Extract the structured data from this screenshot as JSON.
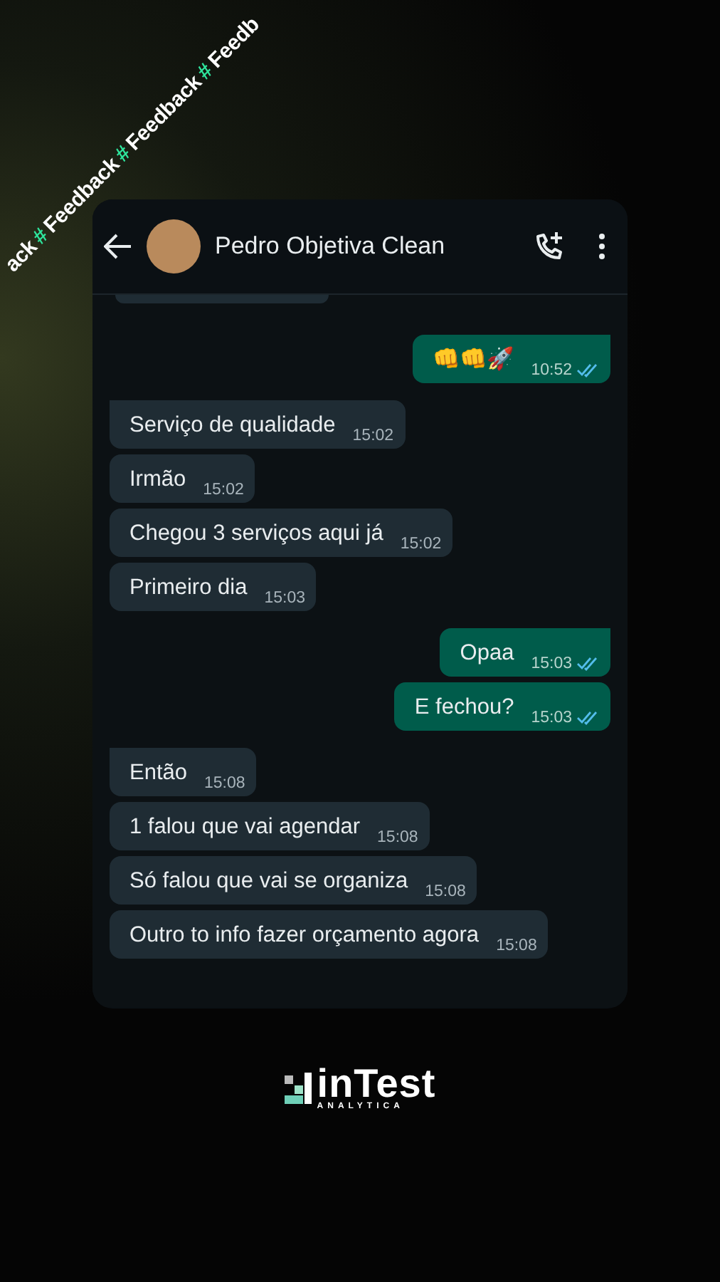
{
  "banner": [
    {
      "text": "ack",
      "accent": false
    },
    {
      "text": "#",
      "accent": true
    },
    {
      "text": "Feedback",
      "accent": false
    },
    {
      "text": "#",
      "accent": true
    },
    {
      "text": "Feedback",
      "accent": false
    },
    {
      "text": "#",
      "accent": true
    },
    {
      "text": "Feedb",
      "accent": false
    }
  ],
  "chat": {
    "contact": "Pedro Objetiva Clean",
    "messages": [
      {
        "kind": "outgoing",
        "text": "👊👊🚀",
        "time": "10:52",
        "read": true
      },
      {
        "kind": "incoming",
        "text": "Serviço de qualidade",
        "time": "15:02"
      },
      {
        "kind": "incoming",
        "text": "Irmão",
        "time": "15:02"
      },
      {
        "kind": "incoming",
        "text": "Chegou 3 serviços aqui já",
        "time": "15:02"
      },
      {
        "kind": "incoming",
        "text": "Primeiro dia",
        "time": "15:03"
      },
      {
        "kind": "outgoing",
        "text": "Opaa",
        "time": "15:03",
        "read": true
      },
      {
        "kind": "outgoing",
        "text": "E fechou?",
        "time": "15:03",
        "read": true
      },
      {
        "kind": "incoming",
        "text": "Então",
        "time": "15:08"
      },
      {
        "kind": "incoming",
        "text": "1 falou que vai agendar",
        "time": "15:08"
      },
      {
        "kind": "incoming",
        "text": "Só falou que vai se organiza",
        "time": "15:08"
      },
      {
        "kind": "incoming",
        "text": "Outro to info fazer orçamento agora",
        "time": "15:08"
      }
    ]
  },
  "brand": {
    "name": "inTest",
    "tagline": "ANALYTICA"
  }
}
